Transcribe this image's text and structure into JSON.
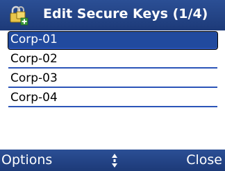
{
  "header": {
    "title": "Edit Secure Keys (1/4)",
    "icon": "lock-key-add-icon"
  },
  "list": {
    "items": [
      {
        "label": "Corp-01",
        "selected": true
      },
      {
        "label": "Corp-02",
        "selected": false
      },
      {
        "label": "Corp-03",
        "selected": false
      },
      {
        "label": "Corp-04",
        "selected": false
      }
    ]
  },
  "softkeys": {
    "left_label": "Options",
    "right_label": "Close",
    "center_icon": "scroll-updown-icon"
  },
  "colors": {
    "bar": "#1d3a78",
    "selection": "#214a9e",
    "divider": "#2b54b8"
  }
}
